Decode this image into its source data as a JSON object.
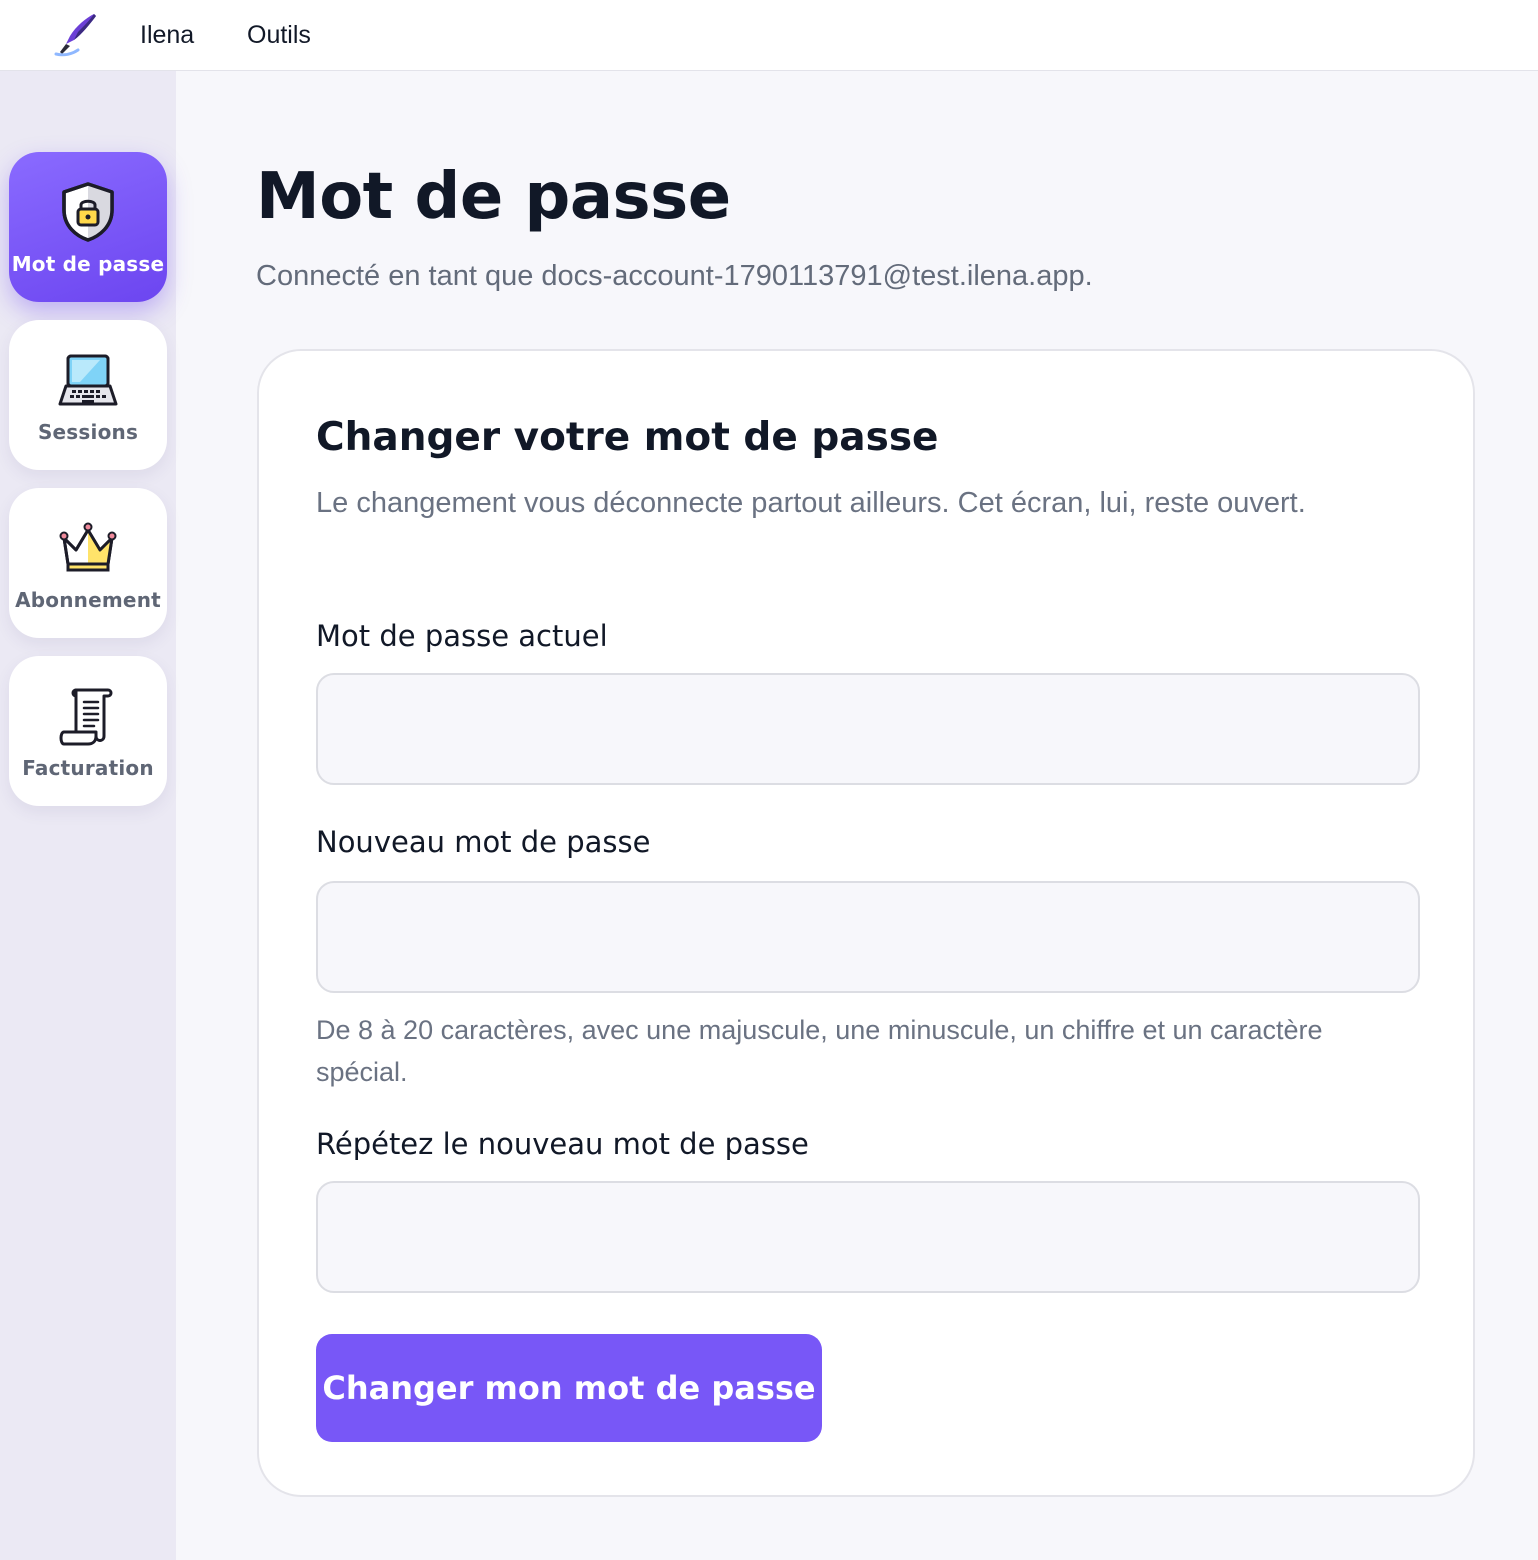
{
  "topbar": {
    "logo_icon": "quill-pen-icon",
    "nav": [
      {
        "label": "Ilena"
      },
      {
        "label": "Outils"
      }
    ]
  },
  "sidebar": {
    "items": [
      {
        "label": "Mot de passe",
        "icon": "shield-lock-icon",
        "active": true
      },
      {
        "label": "Sessions",
        "icon": "laptop-icon",
        "active": false
      },
      {
        "label": "Abonnement",
        "icon": "crown-icon",
        "active": false
      },
      {
        "label": "Facturation",
        "icon": "receipt-scroll-icon",
        "active": false
      }
    ]
  },
  "main": {
    "title": "Mot de passe",
    "subtitle": "Connecté en tant que docs-account-1790113791@test.ilena.app."
  },
  "card": {
    "title": "Changer votre mot de passe",
    "description": "Le changement vous déconnecte partout ailleurs. Cet écran, lui, reste ouvert.",
    "fields": [
      {
        "label": "Mot de passe actuel",
        "value": ""
      },
      {
        "label": "Nouveau mot de passe",
        "value": "",
        "hint": "De 8 à 20 caractères, avec une majuscule, une minuscule, un chiffre et un caractère spécial."
      },
      {
        "label": "Répétez le nouveau mot de passe",
        "value": ""
      }
    ],
    "submit_label": "Changer mon mot de passe"
  },
  "colors": {
    "accent": "#7857f7",
    "active_gradient_start": "#8a6bff",
    "active_gradient_end": "#6c45f0",
    "background": "#f7f7fb",
    "sidebar_bg": "#ebe9f4"
  }
}
